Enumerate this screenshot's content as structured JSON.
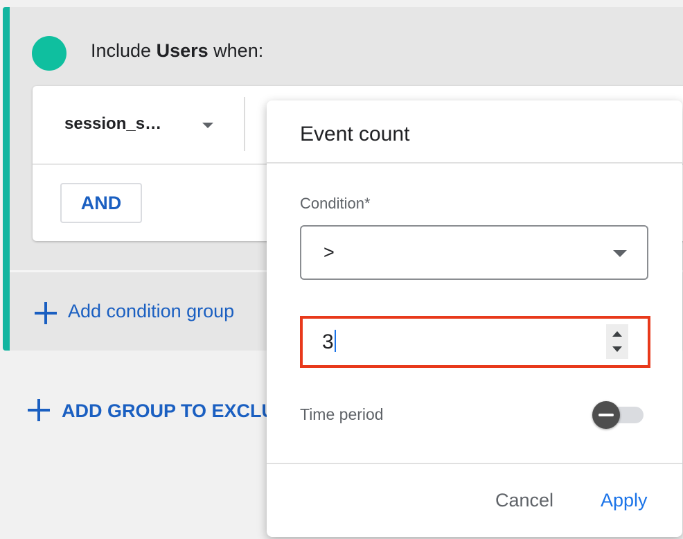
{
  "group": {
    "include_prefix": "Include",
    "include_entity": "Users",
    "include_suffix": "when:",
    "dimension_select": "session_s…",
    "and_button": "AND",
    "add_condition_group": "Add condition group"
  },
  "add_exclude_group": "ADD GROUP TO EXCLU",
  "dialog": {
    "title": "Event count",
    "condition_label": "Condition*",
    "condition_value": ">",
    "count_value": "3",
    "time_period_label": "Time period",
    "time_period_enabled": false,
    "cancel_button": "Cancel",
    "apply_button": "Apply"
  },
  "colors": {
    "accent": "#12b5a0",
    "link_blue": "#1a5fc1",
    "apply_blue": "#1a73e8",
    "highlight_red": "#e8391b"
  }
}
